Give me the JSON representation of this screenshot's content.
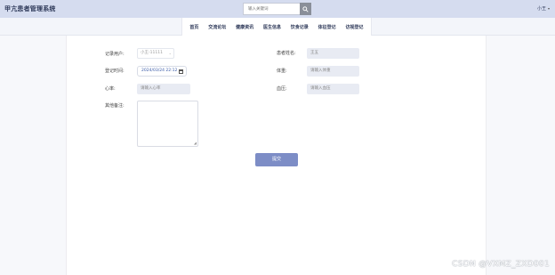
{
  "header": {
    "app_title": "甲亢患者管理系统",
    "search_placeholder": "输入关键词",
    "user_label": "小王"
  },
  "nav": {
    "items": [
      "首页",
      "交流论坛",
      "健康资讯",
      "医生信息",
      "饮食记录",
      "体征登记",
      "访视登记"
    ]
  },
  "form": {
    "record_user_label": "记录用户:",
    "record_user_value": "小王-11111",
    "patient_name_label": "患者姓名:",
    "patient_name_value": "王五",
    "record_time_label": "登记时间:",
    "record_time_value": "2024/03/24 22:12",
    "weight_label": "体重:",
    "weight_placeholder": "请输入体重",
    "heart_rate_label": "心率:",
    "heart_rate_placeholder": "请输入心率",
    "blood_pressure_label": "血压:",
    "blood_pressure_placeholder": "请输入血压",
    "notes_label": "其他备注:",
    "submit_label": "提交"
  },
  "watermark": "CSDN @VXMZ_ZXD001"
}
